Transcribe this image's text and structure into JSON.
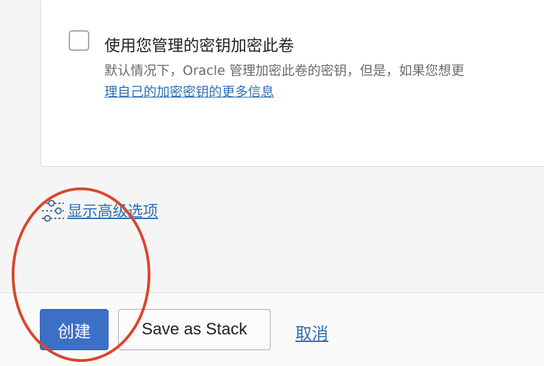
{
  "encryption_option": {
    "checkbox_label": "使用您管理的密钥加密此卷",
    "description": "默认情况下，Oracle 管理加密此卷的密钥，但是，如果您想更",
    "link": "理自己的加密密钥的更多信息",
    "checked": false
  },
  "advanced": {
    "toggle_label": "显示高级选项",
    "icon": "sliders-icon"
  },
  "footer": {
    "create_label": "创建",
    "save_stack_label": "Save as Stack",
    "cancel_label": "取消"
  },
  "colors": {
    "primary": "#3e6fc6",
    "link": "#2b6fb5",
    "annotation": "#d9462b"
  }
}
